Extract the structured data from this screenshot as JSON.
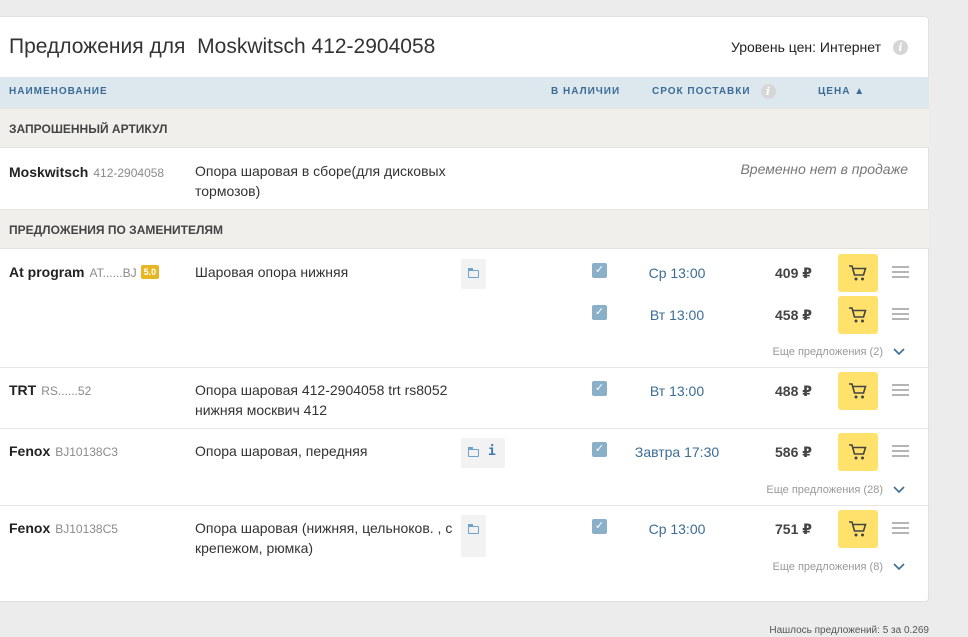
{
  "header": {
    "title_prefix": "Предложения для",
    "title_brand": "Moskwitsch 412-2904058",
    "price_level": "Уровень цен: Интернет"
  },
  "columns": {
    "name": "НАИМЕНОВАНИЕ",
    "in_stock": "В НАЛИЧИИ",
    "delivery": "СРОК ПОСТАВКИ",
    "price": "ЦЕНА ▲"
  },
  "sections": {
    "requested": "ЗАПРОШЕННЫЙ АРТИКУЛ",
    "substitutes": "ПРЕДЛОЖЕНИЯ ПО ЗАМЕНИТЕЛЯМ"
  },
  "requested_item": {
    "brand": "Moskwitsch",
    "article": "412-2904058",
    "description": "Опора шаровая в сборе(для дисковых тормозов)",
    "status": "Временно нет в продаже"
  },
  "offers": [
    {
      "brand": "At program",
      "article": "AT......BJ",
      "rating": "5.0",
      "description": "Шаровая опора нижняя",
      "lines": [
        {
          "in_stock": true,
          "delivery": "Ср 13:00",
          "price": "409 ₽"
        },
        {
          "in_stock": true,
          "delivery": "Вт 13:00",
          "price": "458 ₽"
        }
      ],
      "more": "Еще предложения (2)"
    },
    {
      "brand": "TRT",
      "article": "RS......52",
      "description": "Опора шаровая 412-2904058 trt rs8052 нижняя москвич 412",
      "lines": [
        {
          "in_stock": true,
          "delivery": "Вт 13:00",
          "price": "488 ₽"
        }
      ]
    },
    {
      "brand": "Fenox",
      "article": "BJ10138C3",
      "description": "Опора шаровая, передняя",
      "info_icon": "i",
      "lines": [
        {
          "in_stock": true,
          "delivery": "Завтра 17:30",
          "price": "586 ₽"
        }
      ],
      "more": "Еще предложения (28)"
    },
    {
      "brand": "Fenox",
      "article": "BJ10138C5",
      "description": "Опора шаровая (нижняя, цельнoков. , с крепежом, рюмка)",
      "lines": [
        {
          "in_stock": true,
          "delivery": "Ср 13:00",
          "price": "751 ₽"
        }
      ],
      "more": "Еще предложения (8)"
    }
  ],
  "footer": "Нашлось предложений: 5 за 0.269",
  "icons": {
    "cart": "cart-icon",
    "menu": "menu-icon",
    "chevron": "chevron-down-icon",
    "info": "info-icon",
    "folder": "folder-icon"
  },
  "colors": {
    "accent_blue": "#3b6d96",
    "cart_yellow": "#ffe16b",
    "header_bg": "#dde7ee",
    "section_bg": "#f1efeb",
    "rating_bg": "#e7b622"
  }
}
